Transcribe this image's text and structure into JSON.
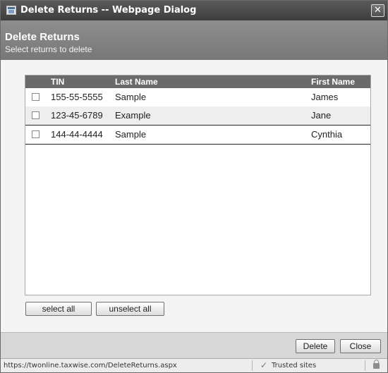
{
  "window": {
    "title": "Delete Returns -- Webpage Dialog",
    "close_glyph": "✕"
  },
  "header": {
    "title": "Delete Returns",
    "subtitle": "Select returns to delete"
  },
  "table": {
    "columns": [
      "TIN",
      "Last Name",
      "First Name"
    ],
    "rows": [
      {
        "tin": "155-55-5555",
        "last_name": "Sample",
        "first_name": "James",
        "checked": false
      },
      {
        "tin": "123-45-6789",
        "last_name": "Example",
        "first_name": "Jane",
        "checked": false
      },
      {
        "tin": "144-44-4444",
        "last_name": "Sample",
        "first_name": "Cynthia",
        "checked": false
      }
    ]
  },
  "selection_buttons": {
    "select_all": "select all",
    "unselect_all": "unselect all"
  },
  "footer": {
    "delete_label": "Delete",
    "close_label": "Close"
  },
  "statusbar": {
    "url": "https://twonline.taxwise.com/DeleteReturns.aspx",
    "zone": "Trusted sites",
    "zone_icon": "check-icon",
    "security_icon": "lock-icon"
  },
  "colors": {
    "titlebar": "#4a4a4a",
    "header_band": "#838383",
    "table_header": "#6a6a6a"
  }
}
